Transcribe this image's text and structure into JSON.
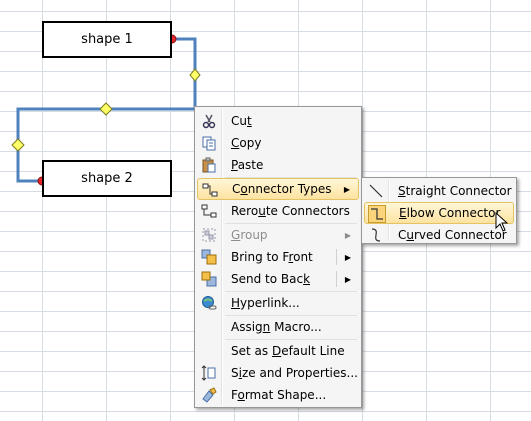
{
  "shapes": {
    "shape1_label": "shape 1",
    "shape2_label": "shape 2"
  },
  "context_menu": {
    "items": [
      {
        "pre": "Cu",
        "acc": "t",
        "post": "",
        "icon": "scissors-icon",
        "enabled": true
      },
      {
        "pre": "",
        "acc": "C",
        "post": "opy",
        "icon": "copy-icon",
        "enabled": true
      },
      {
        "pre": "",
        "acc": "P",
        "post": "aste",
        "icon": "paste-icon",
        "enabled": true
      },
      {
        "pre": "C",
        "acc": "o",
        "post": "nnector Types",
        "icon": "connector-types-icon",
        "enabled": true,
        "submenu": true,
        "highlighted": true
      },
      {
        "pre": "Rero",
        "acc": "u",
        "post": "te Connectors",
        "icon": "reroute-connectors-icon",
        "enabled": true
      },
      {
        "pre": "",
        "acc": "G",
        "post": "roup",
        "icon": "group-icon",
        "enabled": false,
        "submenu": true
      },
      {
        "pre": "Bring to F",
        "acc": "r",
        "post": "ont",
        "icon": "bring-to-front-icon",
        "enabled": true,
        "submenu": true
      },
      {
        "pre": "Send to Bac",
        "acc": "k",
        "post": "",
        "icon": "send-to-back-icon",
        "enabled": true,
        "submenu": true
      },
      {
        "pre": "",
        "acc": "H",
        "post": "yperlink...",
        "icon": "hyperlink-icon",
        "enabled": true
      },
      {
        "pre": "Assig",
        "acc": "n",
        "post": " Macro...",
        "icon": "",
        "enabled": true
      },
      {
        "pre": "Set as ",
        "acc": "D",
        "post": "efault Line",
        "icon": "",
        "enabled": true
      },
      {
        "pre": "S",
        "acc": "i",
        "post": "ze and Properties...",
        "icon": "size-properties-icon",
        "enabled": true
      },
      {
        "pre": "F",
        "acc": "o",
        "post": "rmat Shape...",
        "icon": "format-shape-icon",
        "enabled": true
      }
    ]
  },
  "submenu": {
    "items": [
      {
        "pre": "",
        "acc": "S",
        "post": "traight Connector",
        "icon": "straight-connector-icon"
      },
      {
        "pre": "",
        "acc": "E",
        "post": "lbow Connector",
        "icon": "elbow-connector-icon",
        "highlighted": true
      },
      {
        "pre": "C",
        "acc": "u",
        "post": "rved Connector",
        "icon": "curved-connector-icon"
      }
    ]
  },
  "colors": {
    "connector": "#4f81bd",
    "endpoint": "#e8262a",
    "adjust_handle": "#ffff66",
    "highlight": "#fde3a0"
  }
}
